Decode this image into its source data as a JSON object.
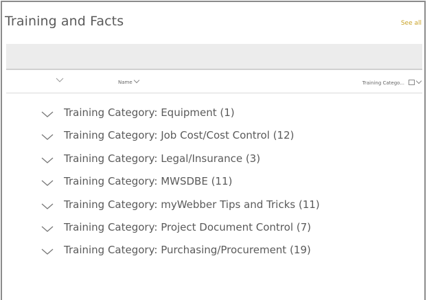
{
  "header": {
    "title": "Training and Facts",
    "see_all": "See all"
  },
  "columns": {
    "name": "Name",
    "training_category": "Training Catego..."
  },
  "icons": {
    "expand_all": "chevron-down-icon",
    "sort": "chevron-down-icon",
    "filter": "filter-icon"
  },
  "groups": [
    {
      "label": "Training Category: Equipment (1)"
    },
    {
      "label": "Training Category: Job Cost/Cost Control (12)"
    },
    {
      "label": "Training Category: Legal/Insurance (3)"
    },
    {
      "label": "Training Category: MWSDBE (11)"
    },
    {
      "label": "Training Category: myWebber Tips and Tricks (11)"
    },
    {
      "label": "Training Category: Project Document Control (7)"
    },
    {
      "label": "Training Category: Purchasing/Procurement (19)"
    }
  ],
  "colors": {
    "accent": "#c9a227",
    "text": "#5a5a5a",
    "toolbar": "#ececec"
  }
}
